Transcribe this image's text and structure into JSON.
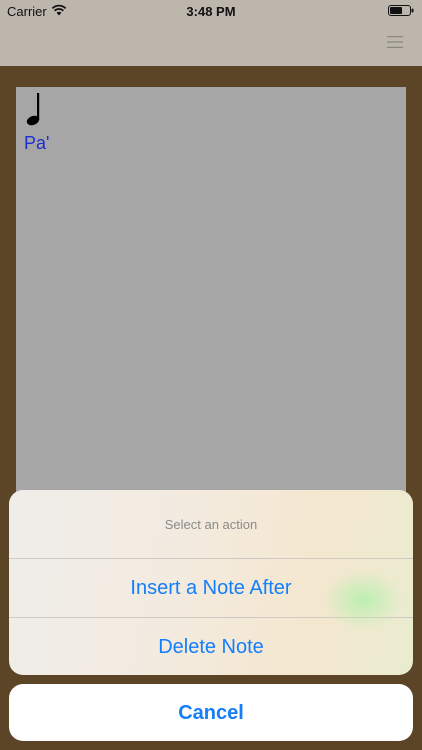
{
  "status_bar": {
    "carrier": "Carrier",
    "time": "3:48 PM"
  },
  "nav": {
    "menu_icon": "hamburger-menu-icon"
  },
  "score": {
    "note_icon": "quarter-note-icon",
    "syllable": "Pa'"
  },
  "action_sheet": {
    "title": "Select an action",
    "actions": [
      {
        "label": "Insert a Note After"
      },
      {
        "label": "Delete Note"
      }
    ],
    "cancel_label": "Cancel"
  },
  "colors": {
    "accent": "#147efb",
    "syllable": "#1c2fd0",
    "background": "#5c4426",
    "score_canvas": "#a6a6a6"
  }
}
